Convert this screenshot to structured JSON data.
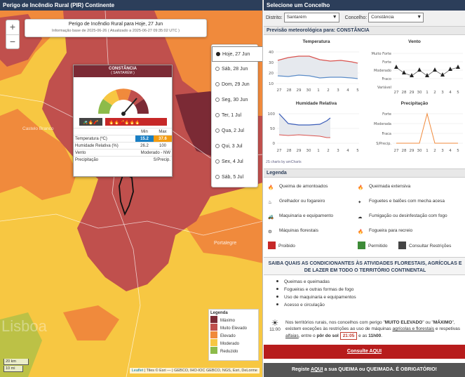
{
  "map": {
    "title": "Perigo de Incêndio Rural (PIR) Continente",
    "zoom_in": "+",
    "zoom_out": "−",
    "info_title": "Perigo de Incêndio Rural para Hoje, 27 Jun",
    "info_sub": "Informação base de 2025-06-26  ( Atualizado a 2025-06-27 09:35:02 UTC )",
    "days": [
      "Hoje, 27 Jun",
      "Sáb, 28 Jun",
      "Dom, 29 Jun",
      "Seg, 30 Jun",
      "Ter, 1 Jul",
      "Qua, 2 Jul",
      "Qui, 3 Jul",
      "Sex, 4 Jul",
      "Sáb, 5 Jul"
    ],
    "selected_day": 0,
    "places": [
      "Castelo Branco",
      "Portalegre",
      "Lisboa"
    ],
    "popup": {
      "title": "CONSTÂNCIA",
      "subtitle": "( SANTARÉM )",
      "col_min": "Min",
      "col_max": "Max",
      "rows": [
        {
          "label": "Temperatura (ºC)",
          "min": "15.2",
          "max": "37.6"
        },
        {
          "label": "Humidade Relativa (%)",
          "min": "26.2",
          "max": "100"
        },
        {
          "label": "Vento",
          "value": "Moderado - NW"
        },
        {
          "label": "Precipitação",
          "value": "S/Precip."
        }
      ],
      "colors": {
        "min_bg": "#1a7fc4",
        "max_bg": "#f39c12"
      }
    },
    "legend": {
      "title": "Legenda",
      "items": [
        {
          "label": "Máximo",
          "color": "#7b2a35"
        },
        {
          "label": "Muito Elevado",
          "color": "#c0504d"
        },
        {
          "label": "Elevado",
          "color": "#f08a3c"
        },
        {
          "label": "Moderado",
          "color": "#f7c742"
        },
        {
          "label": "Reduzido",
          "color": "#8dbb4a"
        }
      ]
    },
    "scale": [
      "20 km",
      "10 mi"
    ],
    "attribution_link": "Leaflet",
    "attribution": "| Tiles © Esri — | GEBCO, IHO-IOC GEBCO, NGS, Esri, DeLorme"
  },
  "panel": {
    "header": "Selecione um Concelho",
    "district_label": "Distrito:",
    "district_value": "Santarém",
    "council_label": "Concelho:",
    "council_value": "Constância",
    "forecast_title": "Previsão meteorológica para: CONSTÂNCIA",
    "charts": {
      "temp_title": "Temperatura",
      "wind_title": "Vento",
      "hum_title": "Humidade Relativa",
      "precip_title": "Precipitação",
      "x_ticks": [
        "27",
        "28",
        "29",
        "30",
        "1",
        "2",
        "3",
        "4",
        "5"
      ],
      "temp_y": [
        "40",
        "30",
        "20",
        "10"
      ],
      "hum_y": [
        "100",
        "50",
        "0"
      ],
      "wind_y": [
        "Muito Forte",
        "Forte",
        "Moderado",
        "Fraco",
        "Variável"
      ],
      "precip_y": [
        "Forte",
        "Moderada",
        "Fraca",
        "S/Precip."
      ],
      "credit": "JS charts by amCharts"
    },
    "legend_title": "Legenda",
    "legend_items": [
      {
        "icon": "campfire-icon",
        "label": "Queima de amontoados"
      },
      {
        "icon": "fire-icon",
        "label": "Queimada extensiva"
      },
      {
        "icon": "grill-icon",
        "label": "Grelhador ou fogareiro"
      },
      {
        "icon": "firework-icon",
        "label": "Foguetes e balões com mecha acesa"
      },
      {
        "icon": "tractor-icon",
        "label": "Maquinaria e equipamento"
      },
      {
        "icon": "smoke-icon",
        "label": "Fumigação ou desinfestação com fogo"
      },
      {
        "icon": "chainsaw-icon",
        "label": "Máquinas florestais"
      },
      {
        "icon": "bonfire-icon",
        "label": "Fogueira para recreio"
      }
    ],
    "status_items": [
      {
        "label": "Proibido",
        "color": "#c62828"
      },
      {
        "label": "Permitido",
        "color": "#3d8b37"
      },
      {
        "label": "Consultar Restrições",
        "color": "#444444"
      }
    ],
    "info_header": "SAIBA QUAIS AS CONDICIONANTES ÀS ATIVIDADES FLORESTAIS, AGRÍCOLAS E DE LAZER EM TODO O TERRITÓRIO CONTINENTAL",
    "info_items": [
      "Queimas e queimadas",
      "Fogueiras e outras formas de fogo",
      "Uso de maquinaria e equipamentos",
      "Acesso e circulação"
    ],
    "sunset_time": "21:05",
    "clock": "11:00",
    "notice_a": "Nos territórios rurais, nos concelhos com perigo \"",
    "notice_b": "MUITO ELEVADO",
    "notice_c": "\" ou \"",
    "notice_d": "MÁXIMO",
    "notice_e": "\", existem exceções às restrições ao uso de máquinas",
    "notice_f": "agrícolas e florestais",
    "notice_g": " e respetivas ",
    "notice_h": "alfaias",
    "notice_i": ", entre o ",
    "notice_j": "pôr do sol",
    "notice_k": " e as ",
    "notice_l": "11h00",
    "notice_m": ".",
    "consult_button": "Consulte AQUI",
    "register_prefix": "Registe ",
    "register_link": "AQUI",
    "register_suffix": " a sua QUEIMA ou QUEIMADA. É OBRIGATÓRIO!"
  }
}
